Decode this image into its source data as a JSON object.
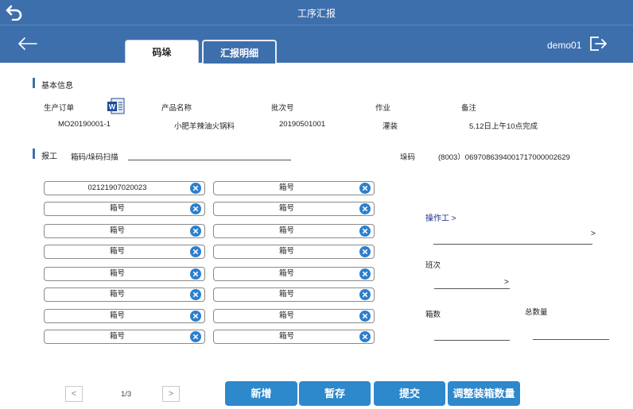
{
  "app": {
    "title": "工序汇报",
    "user": "demo01"
  },
  "tabs": [
    {
      "label": "码垛"
    },
    {
      "label": "汇报明细"
    }
  ],
  "basic": {
    "heading": "基本信息",
    "fields": [
      {
        "label": "生产订单",
        "value": "MO20190001-1"
      },
      {
        "label": "产品名称",
        "value": "小肥羊辣油火锅料"
      },
      {
        "label": "批次号",
        "value": "20190501001"
      },
      {
        "label": "作业",
        "value": "灌装"
      },
      {
        "label": "备注",
        "value": "5.12日上午10点完成"
      }
    ]
  },
  "report": {
    "heading": "报工",
    "scan_label": "箱码/垛码扫描",
    "pallet_label": "垛码",
    "pallet_value": "(8003）0697086394001717000002629"
  },
  "boxes": {
    "left": [
      "02121907020023",
      "箱号",
      "箱号",
      "箱号",
      "箱号",
      "箱号",
      "箱号",
      "箱号"
    ],
    "right": [
      "箱号",
      "箱号",
      "箱号",
      "箱号",
      "箱号",
      "箱号",
      "箱号",
      "箱号"
    ]
  },
  "side": {
    "operator_label": "操作工 >",
    "operator_chevron": ">",
    "shift_label": "班次",
    "shift_chevron": ">",
    "box_count_label": "箱数",
    "total_label": "总数量"
  },
  "pager": {
    "prev": "<",
    "next": ">",
    "text": "1/3"
  },
  "actions": {
    "add": "新增",
    "save": "暂存",
    "submit": "提交",
    "adjust": "调整装箱数量"
  },
  "colors": {
    "primary": "#3d6fad",
    "button": "#2d88cc",
    "clear_icon": "#2b7fd0"
  }
}
